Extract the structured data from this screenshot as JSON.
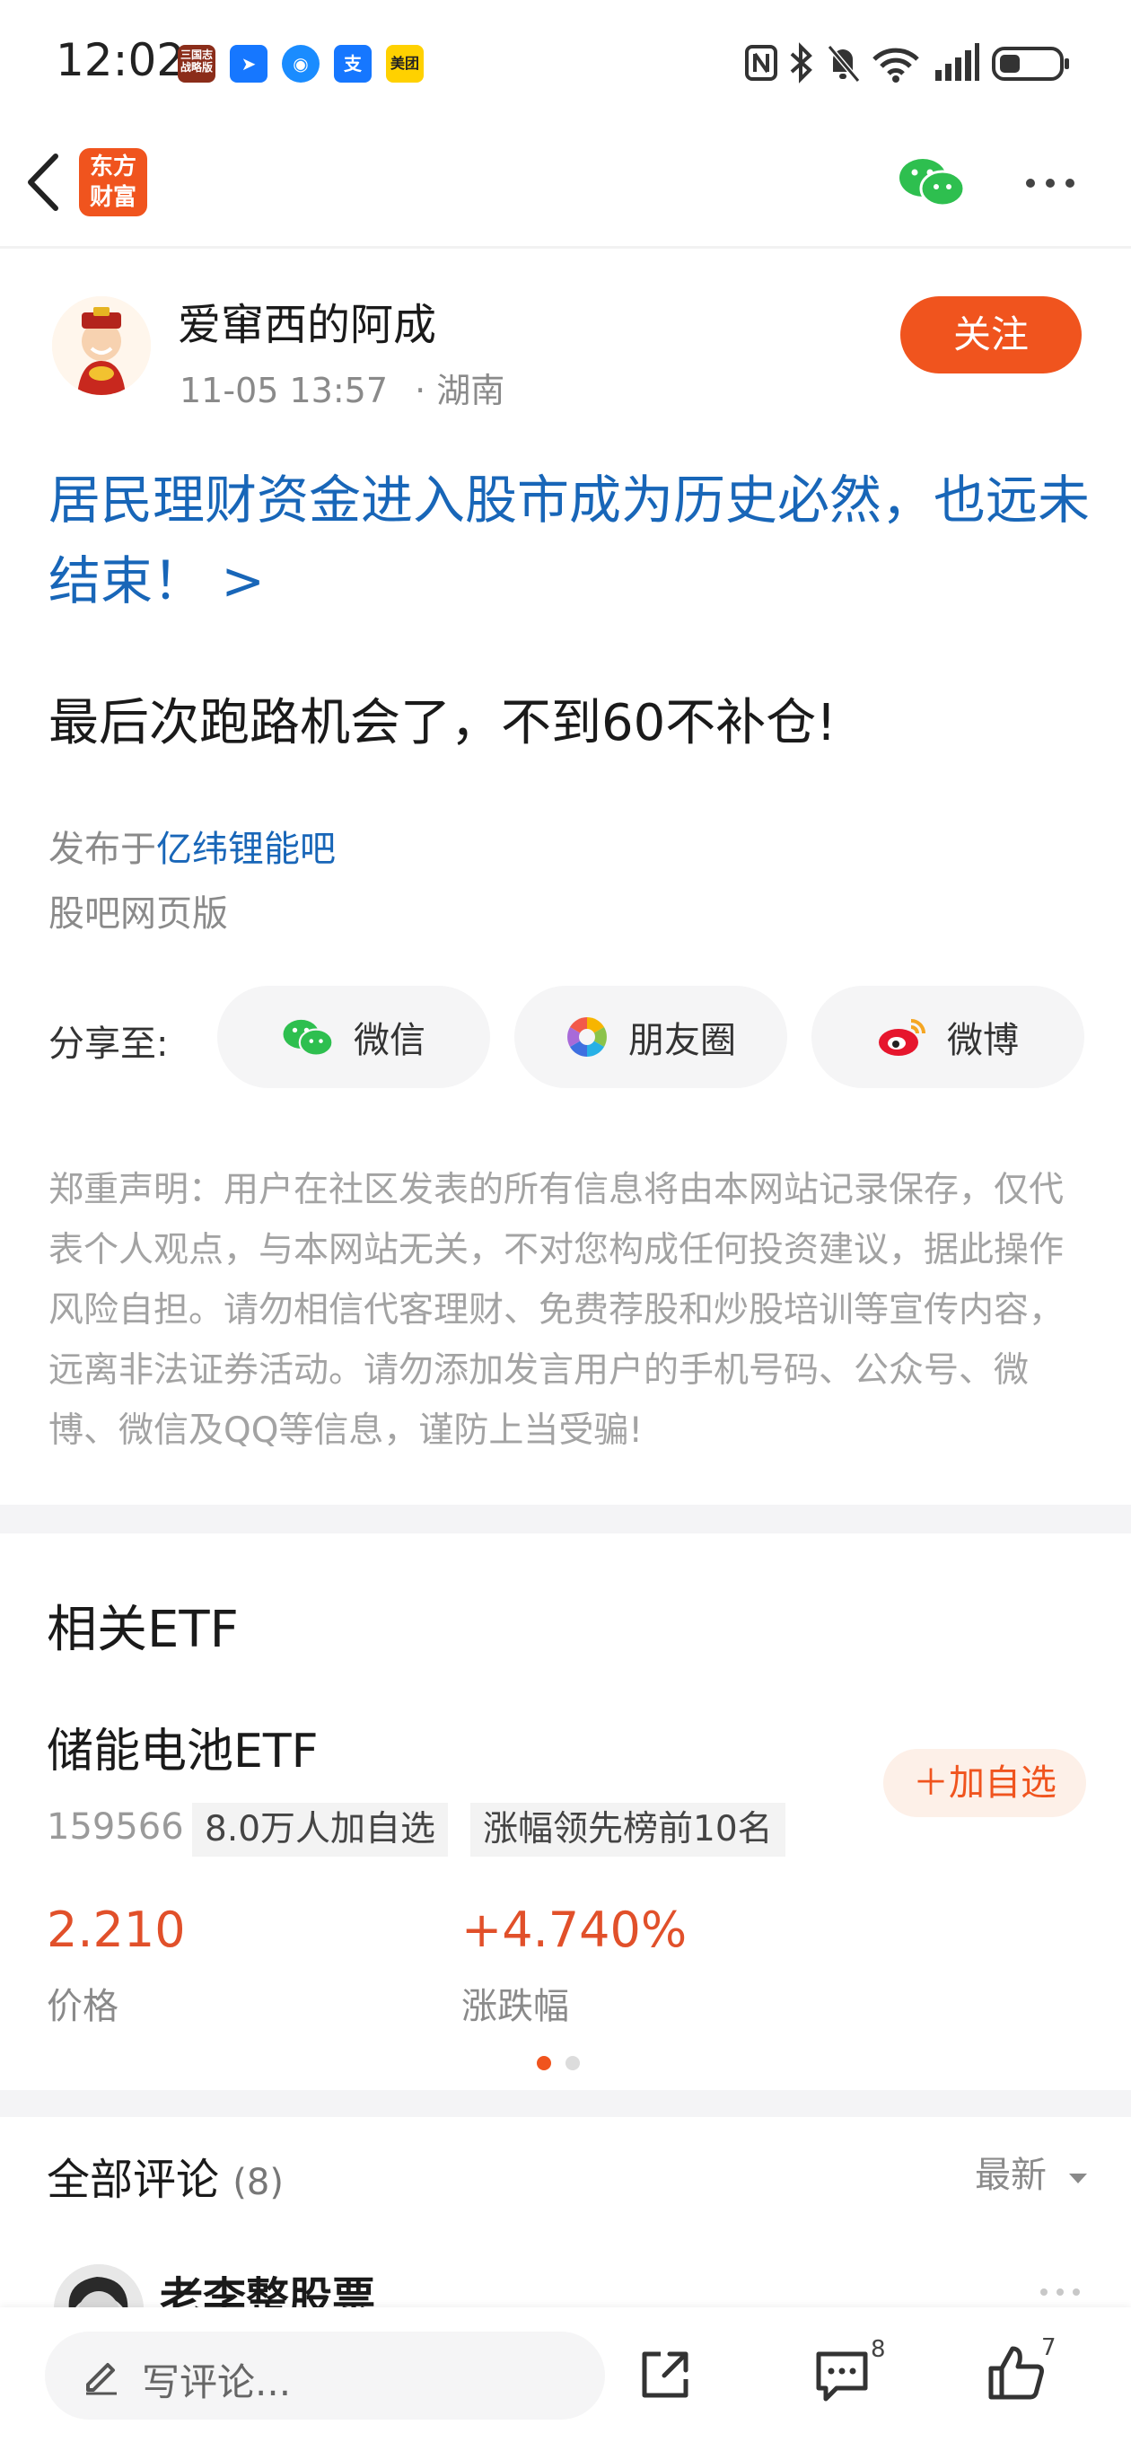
{
  "status_bar": {
    "time": "12:02",
    "app_icons": [
      "三国志 战略版",
      "飞书",
      "福利",
      "支",
      "美团"
    ],
    "sys_icons": [
      "nfc-icon",
      "bluetooth-icon",
      "mute-icon",
      "wifi-icon",
      "signal-icon",
      "battery-icon"
    ]
  },
  "nav": {
    "logo_text": "东方财富",
    "share_wechat_icon": "wechat-icon",
    "more_icon": "more-icon"
  },
  "post": {
    "author": "爱窜西的阿成",
    "datetime": "11-05 13:57",
    "location": "· 湖南",
    "follow_label": "关注",
    "link_title": "居民理财资金进入股市成为历史必然，也远未结束！ >",
    "title": "最后次跑路机会了，不到60不补仓!",
    "published_prefix": "发布于",
    "published_bar": "亿纬锂能吧",
    "platform": "股吧网页版"
  },
  "share": {
    "label": "分享至:",
    "buttons": [
      {
        "label": "微信",
        "icon": "wechat-icon"
      },
      {
        "label": "朋友圈",
        "icon": "moments-icon"
      },
      {
        "label": "微博",
        "icon": "weibo-icon"
      }
    ]
  },
  "disclaimer": "郑重声明：用户在社区发表的所有信息将由本网站记录保存，仅代表个人观点，与本网站无关，不对您构成任何投资建议，据此操作风险自担。请勿相信代客理财、免费荐股和炒股培训等宣传内容，远离非法证券活动。请勿添加发言用户的手机号码、公众号、微博、微信及QQ等信息，谨防上当受骗!",
  "etf": {
    "section_title": "相关ETF",
    "name": "储能电池ETF",
    "code": "159566",
    "tag1": "8.0万人加自选",
    "tag2": "涨幅领先榜前10名",
    "add_label": "＋加自选",
    "price": "2.210",
    "price_label": "价格",
    "change": "+4.740%",
    "change_label": "涨跌幅",
    "accent_color": "#e1502a"
  },
  "comments": {
    "title": "全部评论",
    "count": "(8)",
    "sort_label": "最新",
    "first_commenter": "老李整股票"
  },
  "bottom_bar": {
    "input_placeholder": "写评论...",
    "comment_badge": "8",
    "like_badge": "7"
  },
  "colors": {
    "brand": "#f0541e",
    "link": "#1866b8"
  }
}
